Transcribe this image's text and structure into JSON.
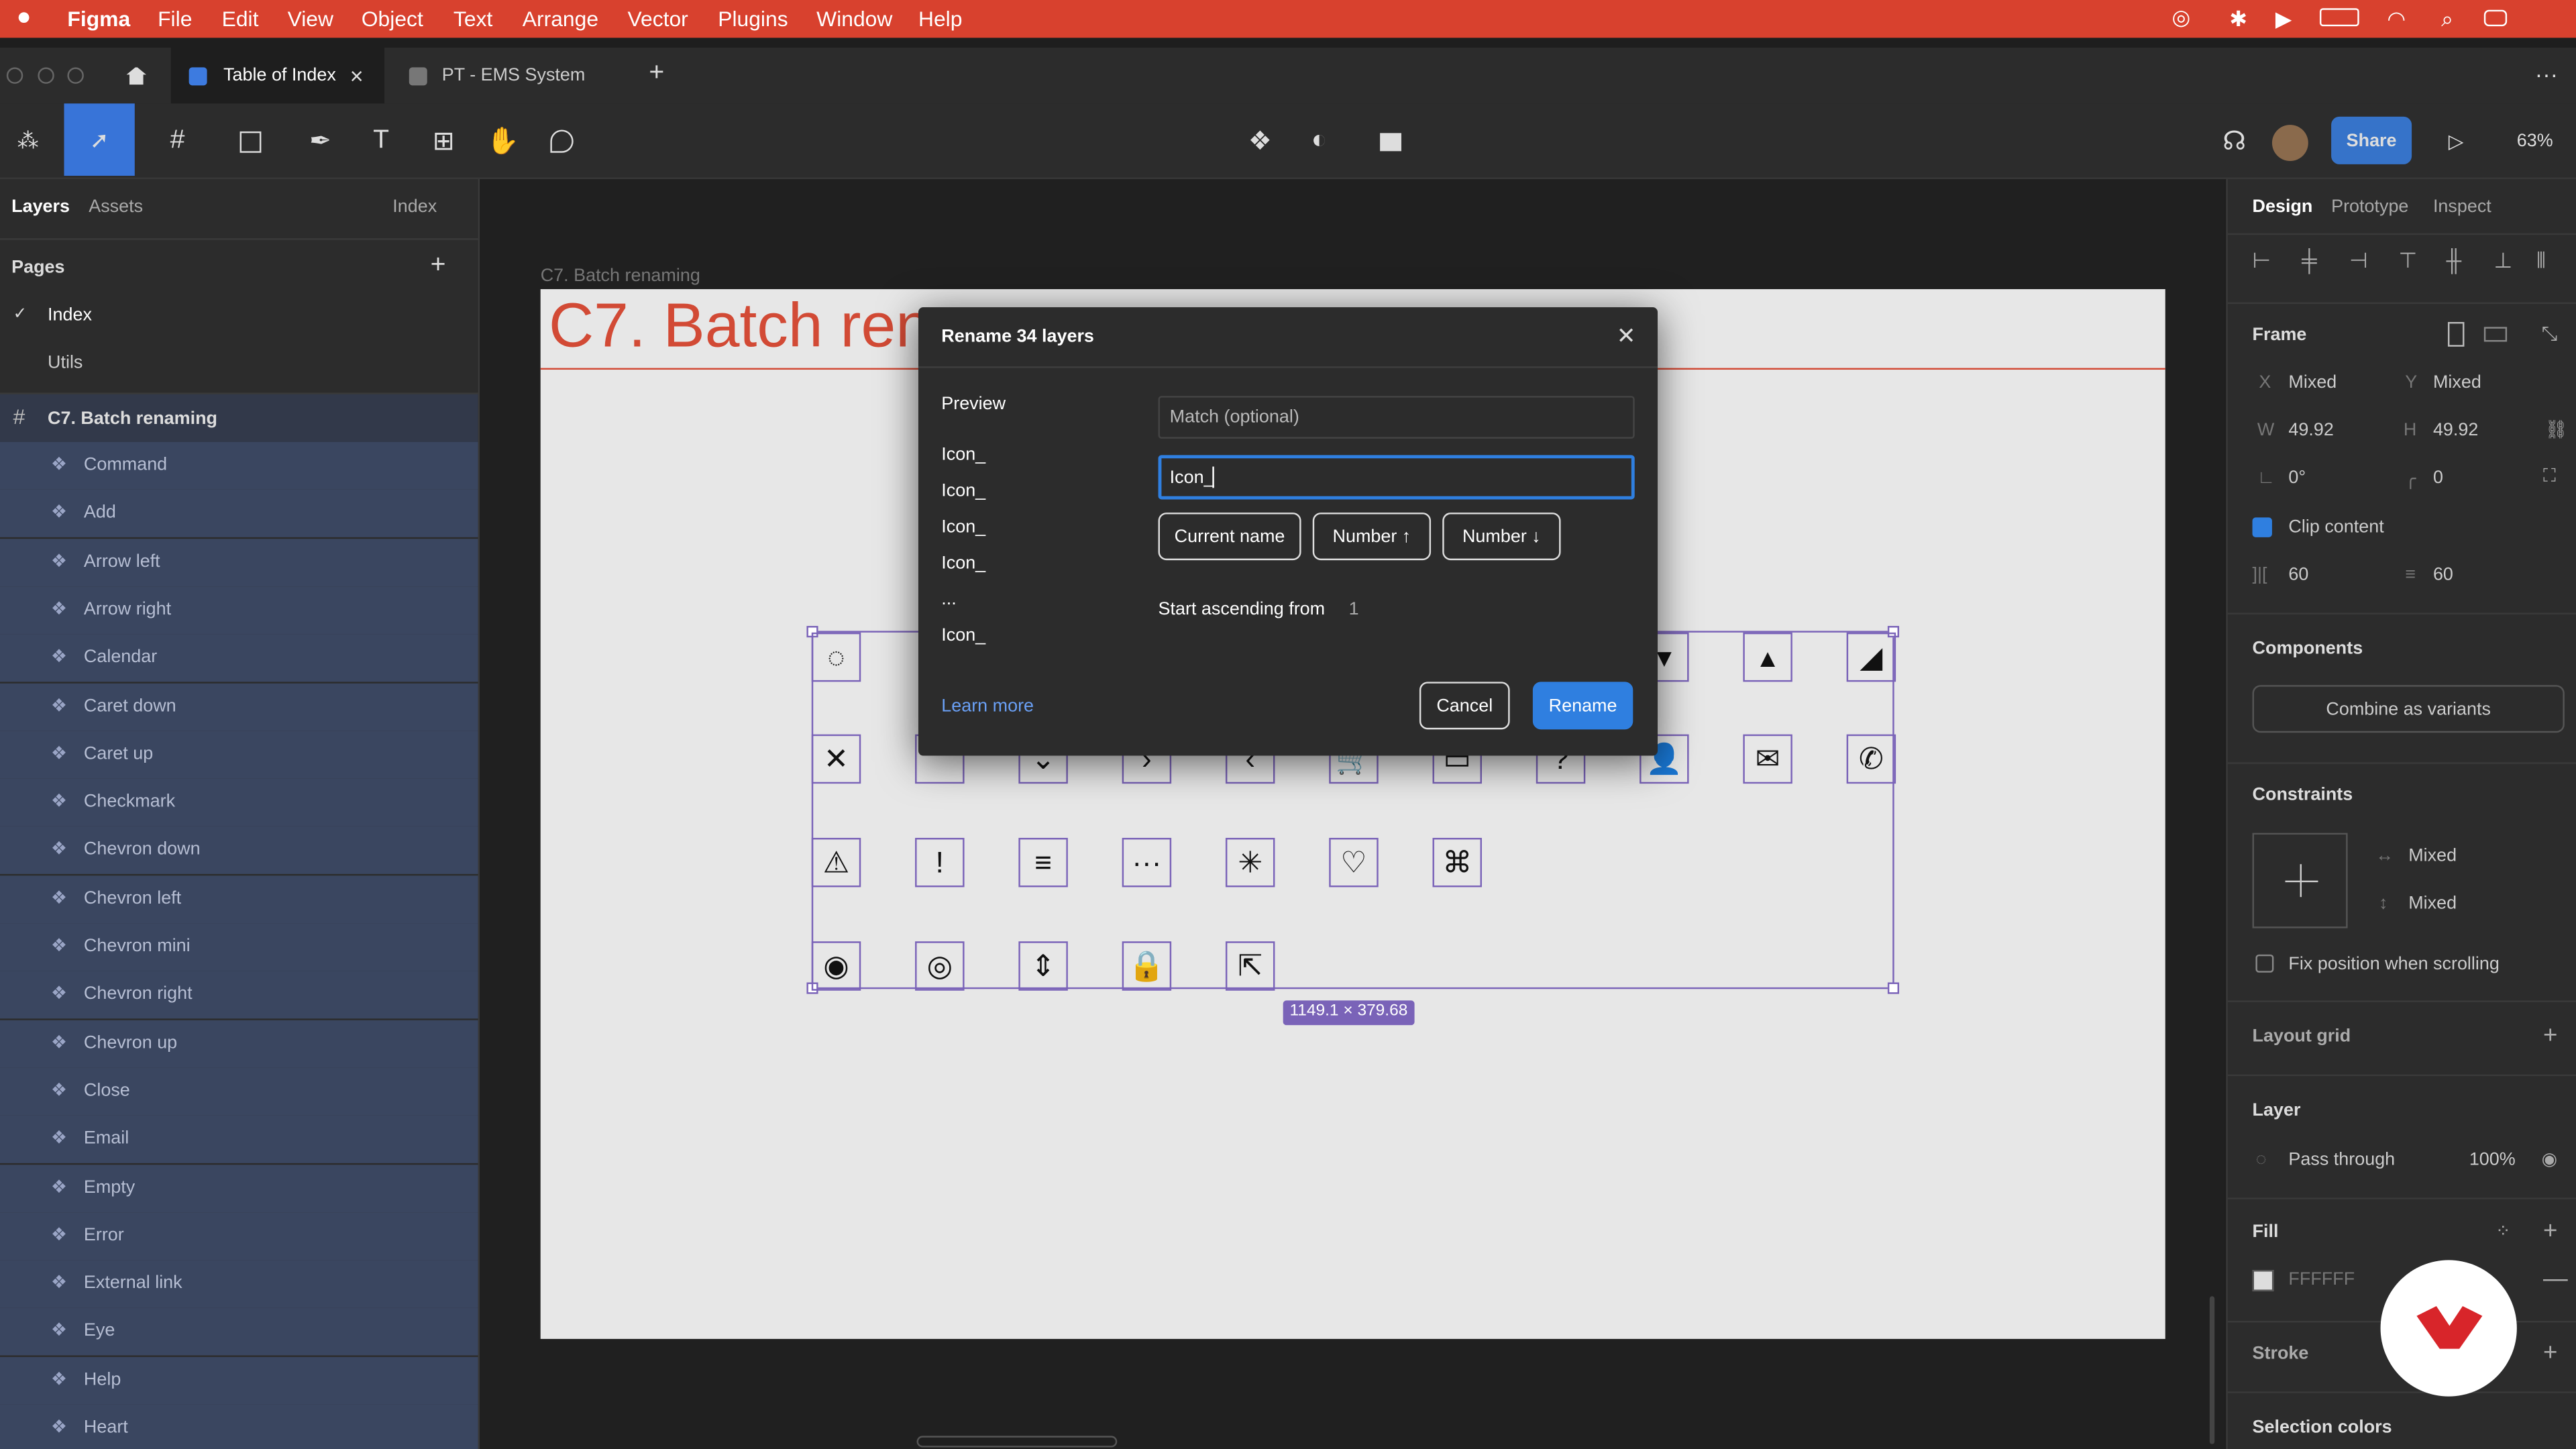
{
  "menubar": {
    "apple_icon": "apple-icon",
    "app_name": "Figma",
    "items": [
      "File",
      "Edit",
      "View",
      "Object",
      "Text",
      "Arrange",
      "Vector",
      "Plugins",
      "Window",
      "Help"
    ]
  },
  "tabs": [
    {
      "label": "Table of Index",
      "close": "×"
    },
    {
      "label": "PT - EMS System"
    }
  ],
  "tabs_add": "+",
  "tabs_more": "···",
  "toolbar": {
    "share_label": "Share",
    "zoom": "63%"
  },
  "left_panel": {
    "tab_layers": "Layers",
    "tab_assets": "Assets",
    "page_selector": "Index",
    "pages_header": "Pages",
    "pages": [
      {
        "label": "Index",
        "check": "✓"
      },
      {
        "label": "Utils"
      }
    ],
    "frame_name": "C7. Batch renaming",
    "layers": [
      "Command",
      "Add",
      "Arrow left",
      "Arrow right",
      "Calendar",
      "Caret down",
      "Caret up",
      "Checkmark",
      "Chevron down",
      "Chevron left",
      "Chevron mini",
      "Chevron right",
      "Chevron up",
      "Close",
      "Email",
      "Empty",
      "Error",
      "External link",
      "Eye",
      "Help",
      "Heart"
    ]
  },
  "canvas": {
    "frame_label": "C7. Batch renaming",
    "frame_heading": "C7.  Batch rena",
    "selection_size": "1149.1 × 379.68",
    "icons_row1_visible": [
      "◌",
      "▾",
      "▴",
      "◢"
    ],
    "icons_row2": [
      "✕",
      "⌃",
      "⌄",
      "›",
      "‹",
      "🛒",
      "▭",
      "?",
      "👤",
      "✉",
      "✆"
    ],
    "icons_row3": [
      "⚠",
      "!",
      "≡",
      "···",
      "✳",
      "♡",
      "⌘"
    ],
    "icons_row4": [
      "◉",
      "◎",
      "⇕",
      "🔒",
      "⇱"
    ]
  },
  "dialog": {
    "title": "Rename 34 layers",
    "close": "✕",
    "preview_label": "Preview",
    "preview_items": [
      "Icon_",
      "Icon_",
      "Icon_",
      "Icon_",
      "...",
      "Icon_"
    ],
    "match_placeholder": "Match (optional)",
    "rename_value": "Icon_",
    "btn_current_name": "Current name",
    "btn_number_up": "Number ↑",
    "btn_number_down": "Number ↓",
    "start_label": "Start ascending from",
    "start_value": "1",
    "learn_more": "Learn more",
    "cancel": "Cancel",
    "rename": "Rename"
  },
  "right_panel": {
    "tabs": [
      "Design",
      "Prototype",
      "Inspect"
    ],
    "frame_label": "Frame",
    "x_label": "X",
    "x_value": "Mixed",
    "y_label": "Y",
    "y_value": "Mixed",
    "w_label": "W",
    "w_value": "49.92",
    "h_label": "H",
    "h_value": "49.92",
    "rotation": "0°",
    "radius": "0",
    "clip_content": "Clip content",
    "gap_h": "60",
    "gap_v": "60",
    "components_header": "Components",
    "combine_variants": "Combine as variants",
    "constraints_header": "Constraints",
    "constraint_h": "Mixed",
    "constraint_v": "Mixed",
    "fix_position": "Fix position when scrolling",
    "layout_grid": "Layout grid",
    "layer_header": "Layer",
    "blend_mode": "Pass through",
    "opacity": "100%",
    "fill_header": "Fill",
    "fill_value": "FFFFFF",
    "stroke_header": "Stroke",
    "selection_colors": "Selection colors"
  },
  "colors": {
    "menubar": "#d8412e",
    "accent": "#2f7fe0",
    "selection": "#7a63b8",
    "share": "#3673c9"
  }
}
